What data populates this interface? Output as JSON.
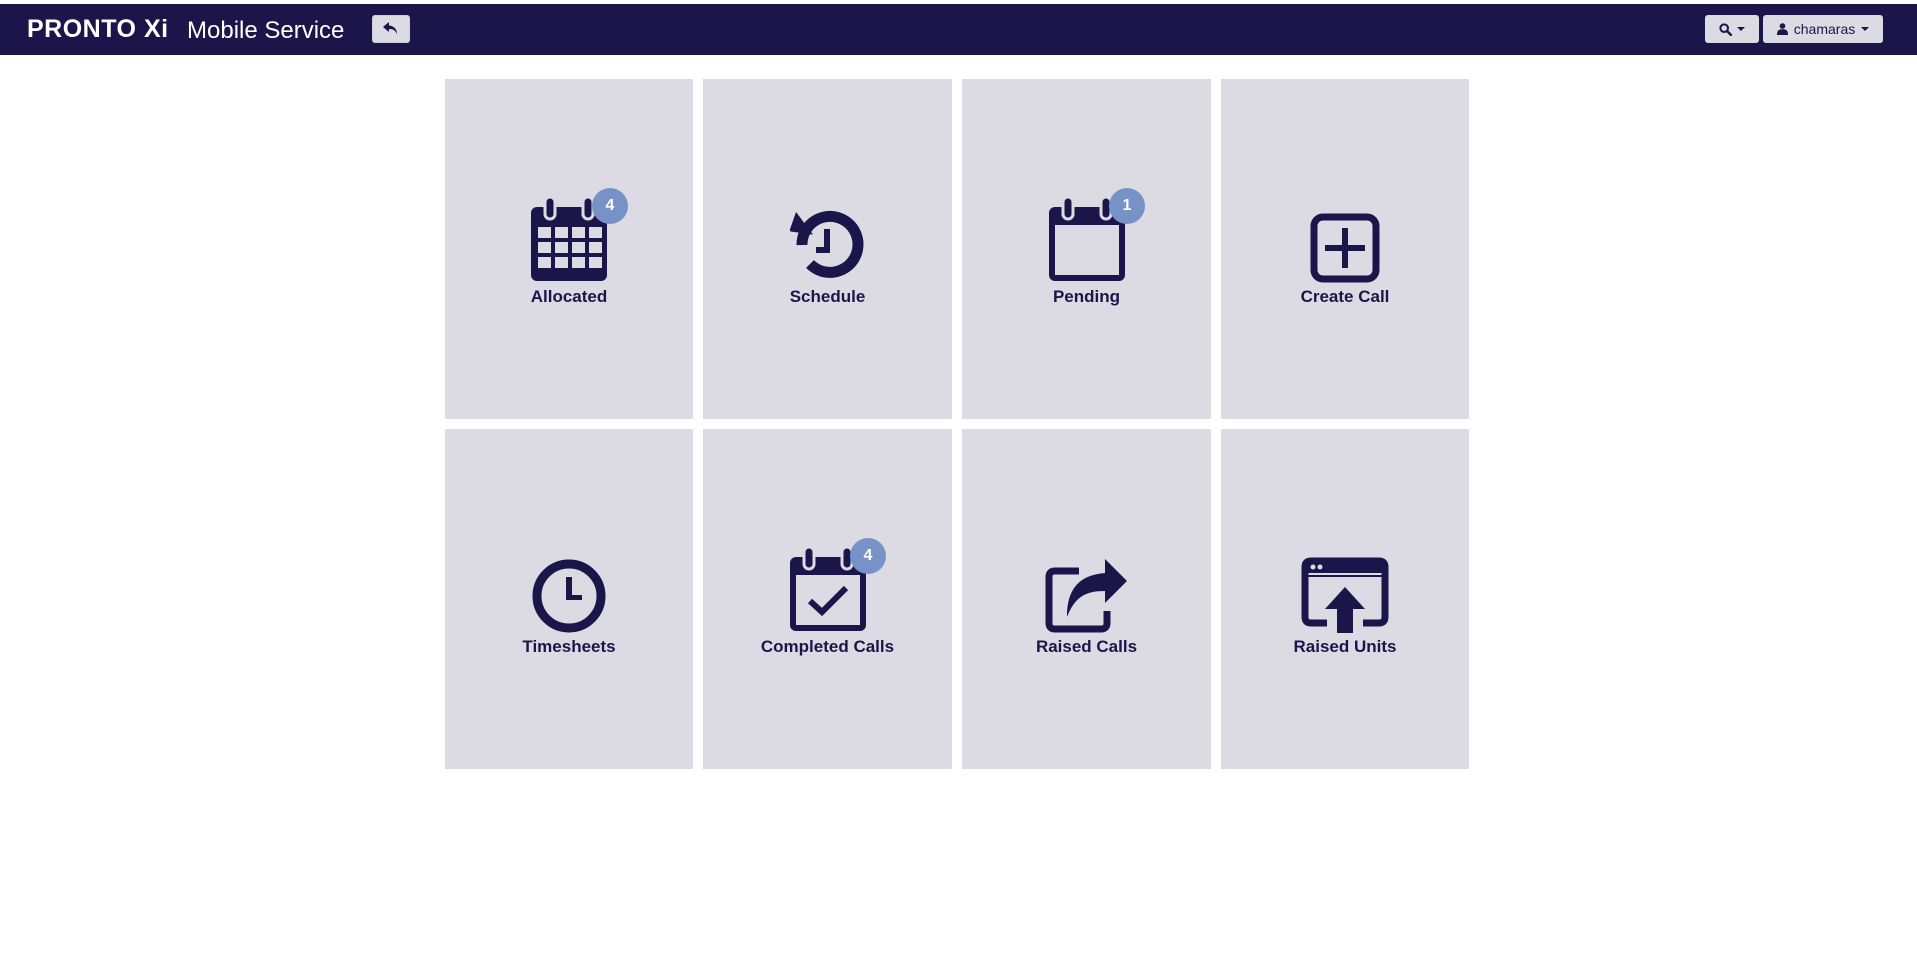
{
  "header": {
    "logo": "PRONTO Xi",
    "title": "Mobile Service",
    "back_icon": "reply-icon",
    "search_icon": "search-icon",
    "user_icon": "user-icon",
    "username": "chamaras"
  },
  "tiles": [
    {
      "label": "Allocated",
      "icon": "calendar-grid-icon",
      "badge": "4"
    },
    {
      "label": "Schedule",
      "icon": "history-icon",
      "badge": ""
    },
    {
      "label": "Pending",
      "icon": "calendar-empty-icon",
      "badge": "1"
    },
    {
      "label": "Create Call",
      "icon": "plus-square-icon",
      "badge": ""
    },
    {
      "label": "Timesheets",
      "icon": "clock-icon",
      "badge": ""
    },
    {
      "label": "Completed Calls",
      "icon": "calendar-check-icon",
      "badge": "4"
    },
    {
      "label": "Raised Calls",
      "icon": "share-square-icon",
      "badge": ""
    },
    {
      "label": "Raised Units",
      "icon": "upload-window-icon",
      "badge": ""
    }
  ],
  "colors": {
    "navbar": "#1c1549",
    "tile": "#dcdae3",
    "icon": "#1c1549",
    "badge": "#7792c7"
  }
}
